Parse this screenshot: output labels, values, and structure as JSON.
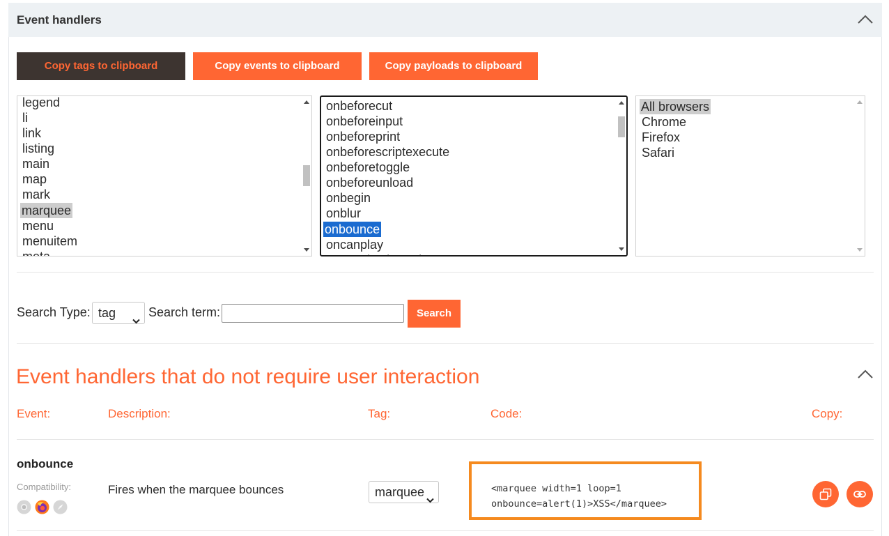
{
  "panel": {
    "title": "Event handlers"
  },
  "buttons": {
    "copy_tags": "Copy tags to clipboard",
    "copy_events": "Copy events to clipboard",
    "copy_payloads": "Copy payloads to clipboard"
  },
  "tags_list": {
    "items": [
      "legend",
      "li",
      "link",
      "listing",
      "main",
      "map",
      "mark",
      "marquee",
      "menu",
      "menuitem",
      "meta"
    ],
    "selected": "marquee"
  },
  "events_list": {
    "items": [
      "onbeforecut",
      "onbeforeinput",
      "onbeforeprint",
      "onbeforescriptexecute",
      "onbeforetoggle",
      "onbeforeunload",
      "onbegin",
      "onblur",
      "onbounce",
      "oncanplay",
      "oncanplaythrough"
    ],
    "selected": "onbounce"
  },
  "browsers_list": {
    "items": [
      "All browsers",
      "Chrome",
      "Firefox",
      "Safari"
    ],
    "selected": "All browsers"
  },
  "search": {
    "type_label": "Search Type:",
    "type_value": "tag",
    "term_label": "Search term:",
    "term_value": "",
    "button": "Search"
  },
  "section": {
    "title": "Event handlers that do not require user interaction",
    "columns": {
      "event": "Event:",
      "description": "Description:",
      "tag": "Tag:",
      "code": "Code:",
      "copy": "Copy:"
    }
  },
  "row": {
    "event": "onbounce",
    "compat_label": "Compatibility:",
    "compat_icons": [
      "chrome-icon",
      "firefox-icon",
      "safari-icon"
    ],
    "description": "Fires when the marquee bounces",
    "tag_select": "marquee",
    "code_line1": "<marquee width=1 loop=1",
    "code_line2": "onbounce=alert(1)>XSS</marquee>",
    "copy_icons": [
      "copy-icon",
      "link-icon"
    ]
  },
  "colors": {
    "accent": "#ff6633",
    "dark_button": "#3d3430",
    "header_bg": "#edf1f4",
    "selection_blue": "#1a6bd0",
    "code_border": "#f58a1f"
  }
}
